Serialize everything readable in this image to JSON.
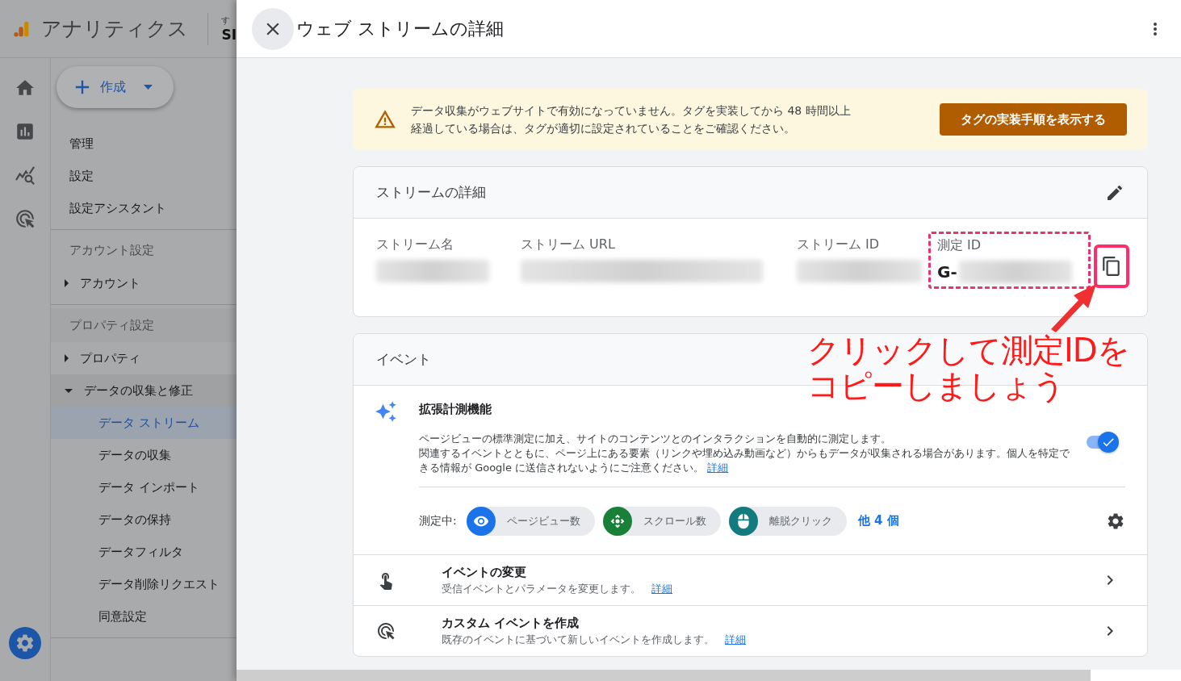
{
  "app": {
    "name": "アナリティクス",
    "account_label": "す",
    "account_name": "SI"
  },
  "create_button": {
    "label": "作成"
  },
  "nav": [
    {
      "items": [
        {
          "kind": "link",
          "label": "管理"
        },
        {
          "kind": "link",
          "label": "設定"
        },
        {
          "kind": "link",
          "label": "設定アシスタント"
        }
      ]
    },
    {
      "heading": "アカウント設定",
      "items": [
        {
          "kind": "group",
          "label": "アカウント",
          "expanded": false
        }
      ]
    },
    {
      "heading": "プロパティ設定",
      "items": [
        {
          "kind": "group",
          "label": "プロパティ",
          "expanded": false
        },
        {
          "kind": "group",
          "label": "データの収集と修正",
          "expanded": true,
          "children": [
            {
              "label": "データ ストリーム",
              "selected": true
            },
            {
              "label": "データの収集",
              "selected": false
            },
            {
              "label": "データ インポート",
              "selected": false
            },
            {
              "label": "データの保持",
              "selected": false
            },
            {
              "label": "データフィルタ",
              "selected": false
            },
            {
              "label": "データ削除リクエスト",
              "selected": false
            },
            {
              "label": "同意設定",
              "selected": false
            }
          ]
        }
      ]
    }
  ],
  "panel": {
    "title": "ウェブ ストリームの詳細"
  },
  "banner": {
    "message": [
      "データ収集がウェブサイトで有効になっていません。タグを実装してから 48 時間以上",
      "経過している場合は、タグが適切に設定されていることをご確認ください。"
    ],
    "button": "タグの実装手順を表示する"
  },
  "stream_details": {
    "title": "ストリームの詳細",
    "fields": [
      {
        "label": "ストリーム名",
        "kind": "blurred",
        "highlighted": false
      },
      {
        "label": "ストリーム URL",
        "kind": "blurred",
        "highlighted": false
      },
      {
        "label": "ストリーム ID",
        "kind": "blurred",
        "highlighted": false
      },
      {
        "label": "測定 ID",
        "kind": "partial",
        "value": "G-",
        "highlighted": true
      }
    ],
    "copy_highlighted": true
  },
  "events": {
    "title": "イベント",
    "enhanced": {
      "title": "拡張計測機能",
      "description": [
        "ページビューの標準測定に加え、サイトのコンテンツとのインタラクションを自動的に測定します。",
        "関連するイベントとともに、ページ上にある要素（リンクや埋め込み動画など）からもデータが収集される場合があります。個人を特定できる情報が Google に送信されないようにご注意ください。"
      ],
      "link": "詳細",
      "on": true,
      "measuring_label": "測定中:",
      "chips": [
        {
          "kind": "pageview",
          "label": "ページビュー数",
          "color": "#1a73e8"
        },
        {
          "kind": "scroll",
          "label": "スクロール数",
          "color": "#188038"
        },
        {
          "kind": "click",
          "label": "離脱クリック",
          "color": "#137b7f"
        }
      ],
      "more": "他 4 個"
    },
    "rows": [
      {
        "kind": "modify",
        "title": "イベントの変更",
        "description": "受信イベントとパラメータを変更します。",
        "link": "詳細"
      },
      {
        "kind": "create",
        "title": "カスタム イベントを作成",
        "description": "既存のイベントに基づいて新しいイベントを作成します。",
        "link": "詳細"
      }
    ]
  },
  "annotation": {
    "lines": [
      "クリックして測定IDを",
      "コピーしましょう"
    ]
  }
}
